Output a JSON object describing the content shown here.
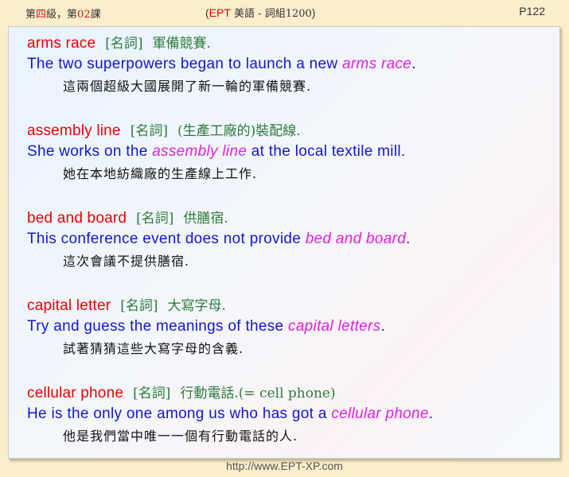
{
  "header": {
    "lesson_prefix": "第",
    "lesson_grade": "四",
    "lesson_mid": "級，第",
    "lesson_num": "02",
    "lesson_suffix": "課",
    "title_open": "(",
    "title_ept": "EPT",
    "title_cn": " 美語 - 詞組1200",
    "title_close": ")",
    "page": "P122"
  },
  "entries": [
    {
      "term": "arms race",
      "pos": "[名詞]",
      "definition": "軍備競賽.",
      "sentence_before": "The two superpowers began to launch a new ",
      "sentence_highlight": "arms race",
      "sentence_after": ".",
      "translation": "這兩個超級大國展開了新一輪的軍備競賽."
    },
    {
      "term": "assembly line",
      "pos": "[名詞]",
      "definition": "(生產工廠的)裝配線.",
      "sentence_before": "She works on the ",
      "sentence_highlight": "assembly line",
      "sentence_after": " at the local textile mill.",
      "translation": "她在本地紡織廠的生產線上工作."
    },
    {
      "term": "bed and board",
      "pos": "[名詞]",
      "definition": "供膳宿.",
      "sentence_before": "This conference event does not provide ",
      "sentence_highlight": "bed and board",
      "sentence_after": ".",
      "translation": "這次會議不提供膳宿."
    },
    {
      "term": "capital letter",
      "pos": "[名詞]",
      "definition": "大寫字母.",
      "sentence_before": "Try and guess the meanings of these ",
      "sentence_highlight": "capital letters",
      "sentence_after": ".",
      "translation": "試著猜猜這些大寫字母的含義."
    },
    {
      "term": "cellular phone",
      "pos": "[名詞]",
      "definition": "行動電話.(= cell phone)",
      "sentence_before": "He is the only one among us who has got a ",
      "sentence_highlight": "cellular phone",
      "sentence_after": ".",
      "translation": "他是我們當中唯一一個有行動電話的人."
    }
  ],
  "footer": {
    "url": "http://www.EPT-XP.com"
  }
}
